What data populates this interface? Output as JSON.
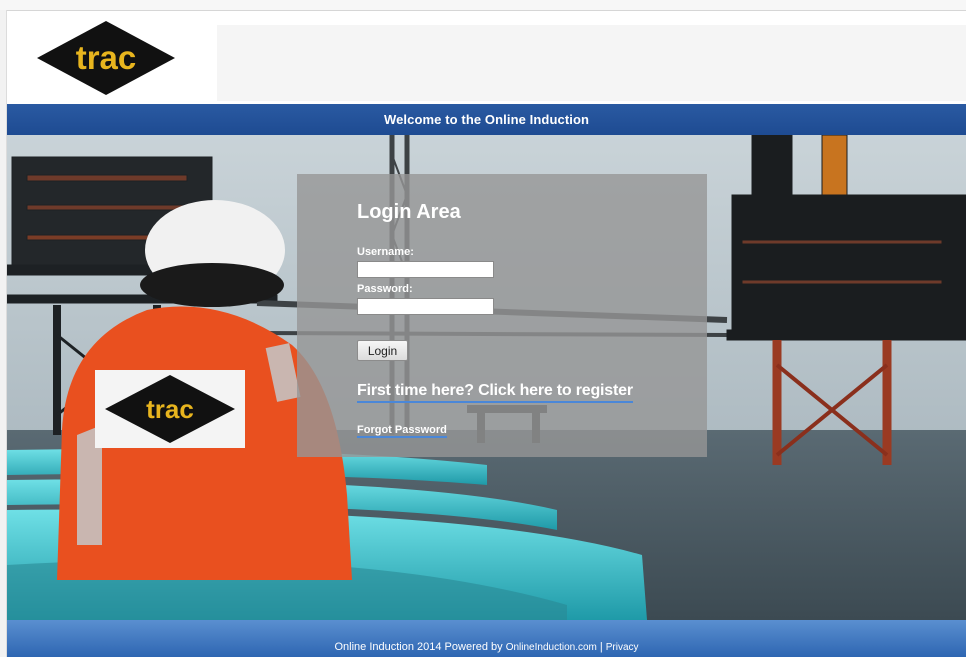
{
  "brand": {
    "logo_text": "trac",
    "colors": {
      "diamond": "#111111",
      "logo_text": "#e8b51e"
    }
  },
  "header": {
    "welcome": "Welcome to the Online Induction",
    "bar_color": "#1e4b92"
  },
  "hero": {
    "vest_logo_text": "trac",
    "colors": {
      "vest": "#e9501f",
      "sea": "#4b5a64",
      "sky": "#b9c3c8",
      "pipe": "#39c3cf"
    }
  },
  "login": {
    "title": "Login Area",
    "username_label": "Username:",
    "username_value": "",
    "password_label": "Password:",
    "password_value": "",
    "button_label": "Login",
    "register_link": "First time here? Click here to register",
    "forgot_link": "Forgot Password"
  },
  "footer": {
    "text": "Online Induction 2014 Powered by",
    "brand_link": "OnlineInduction.com",
    "separator": "|",
    "privacy_link": "Privacy"
  }
}
